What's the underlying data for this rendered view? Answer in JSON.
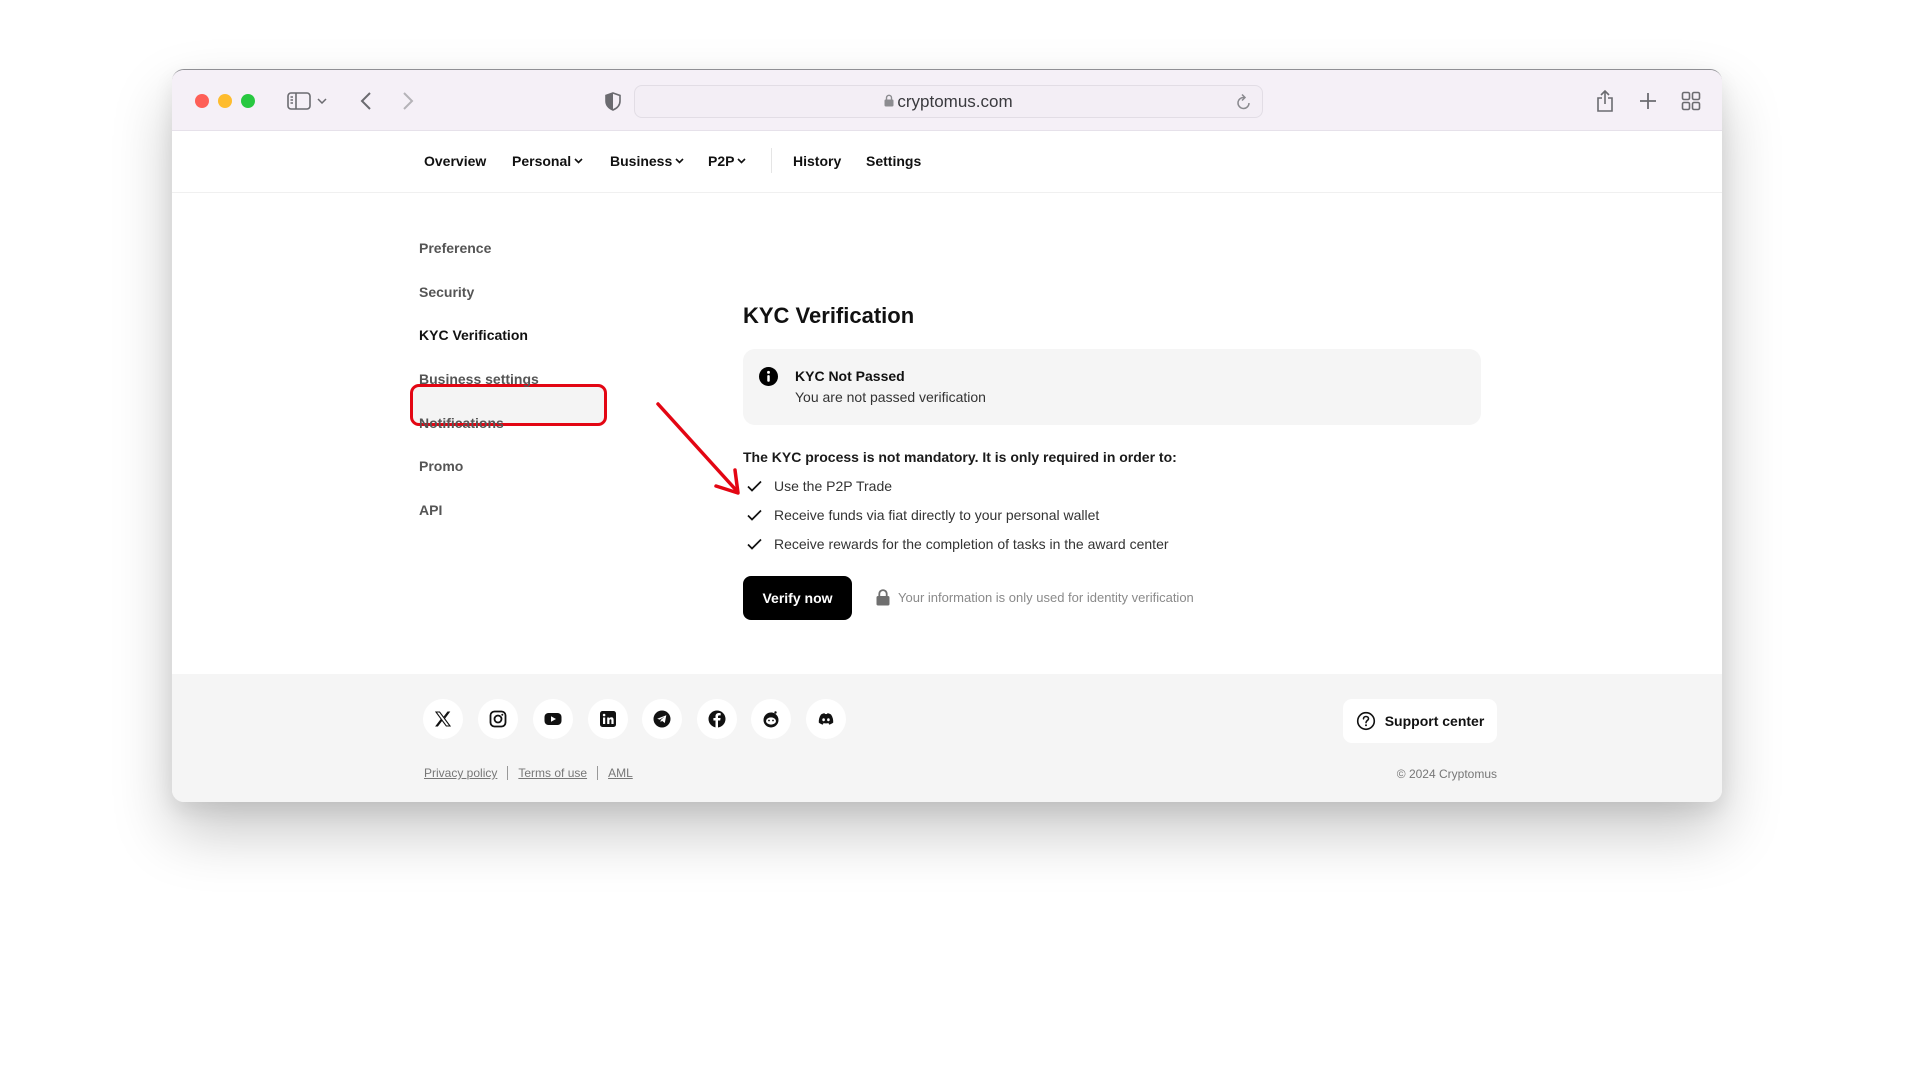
{
  "browser": {
    "url": "cryptomus.com"
  },
  "nav": {
    "items": [
      {
        "label": "Overview",
        "has_dropdown": false
      },
      {
        "label": "Personal",
        "has_dropdown": true
      },
      {
        "label": "Business",
        "has_dropdown": true
      },
      {
        "label": "P2P",
        "has_dropdown": true
      },
      {
        "label": "History",
        "has_dropdown": false
      },
      {
        "label": "Settings",
        "has_dropdown": false
      }
    ]
  },
  "sidebar": {
    "items": [
      {
        "label": "Preference",
        "active": false
      },
      {
        "label": "Security",
        "active": false
      },
      {
        "label": "KYC Verification",
        "active": true
      },
      {
        "label": "Business settings",
        "active": false
      },
      {
        "label": "Notifications",
        "active": false
      },
      {
        "label": "Promo",
        "active": false
      },
      {
        "label": "API",
        "active": false
      }
    ]
  },
  "main": {
    "title": "KYC Verification",
    "alert": {
      "icon": "info-icon",
      "title": "KYC Not Passed",
      "text": "You are not passed verification"
    },
    "intro": "The KYC process is not mandatory. It is only required in order to:",
    "requirements": [
      "Use the P2P Trade",
      "Receive funds via fiat directly to your personal wallet",
      "Receive rewards for the completion of tasks in the award center"
    ],
    "verify_button": "Verify now",
    "privacy_note": "Your information is only used for identity verification"
  },
  "annotation": {
    "color": "#e30613",
    "highlight_target": "KYC Verification",
    "arrow_target": "Verify now"
  },
  "footer": {
    "socials": [
      "x-icon",
      "instagram-icon",
      "youtube-icon",
      "linkedin-icon",
      "telegram-icon",
      "facebook-icon",
      "reddit-icon",
      "discord-icon"
    ],
    "support_label": "Support center",
    "links": [
      "Privacy policy",
      "Terms of use",
      "AML"
    ],
    "copyright": "© 2024 Cryptomus"
  }
}
